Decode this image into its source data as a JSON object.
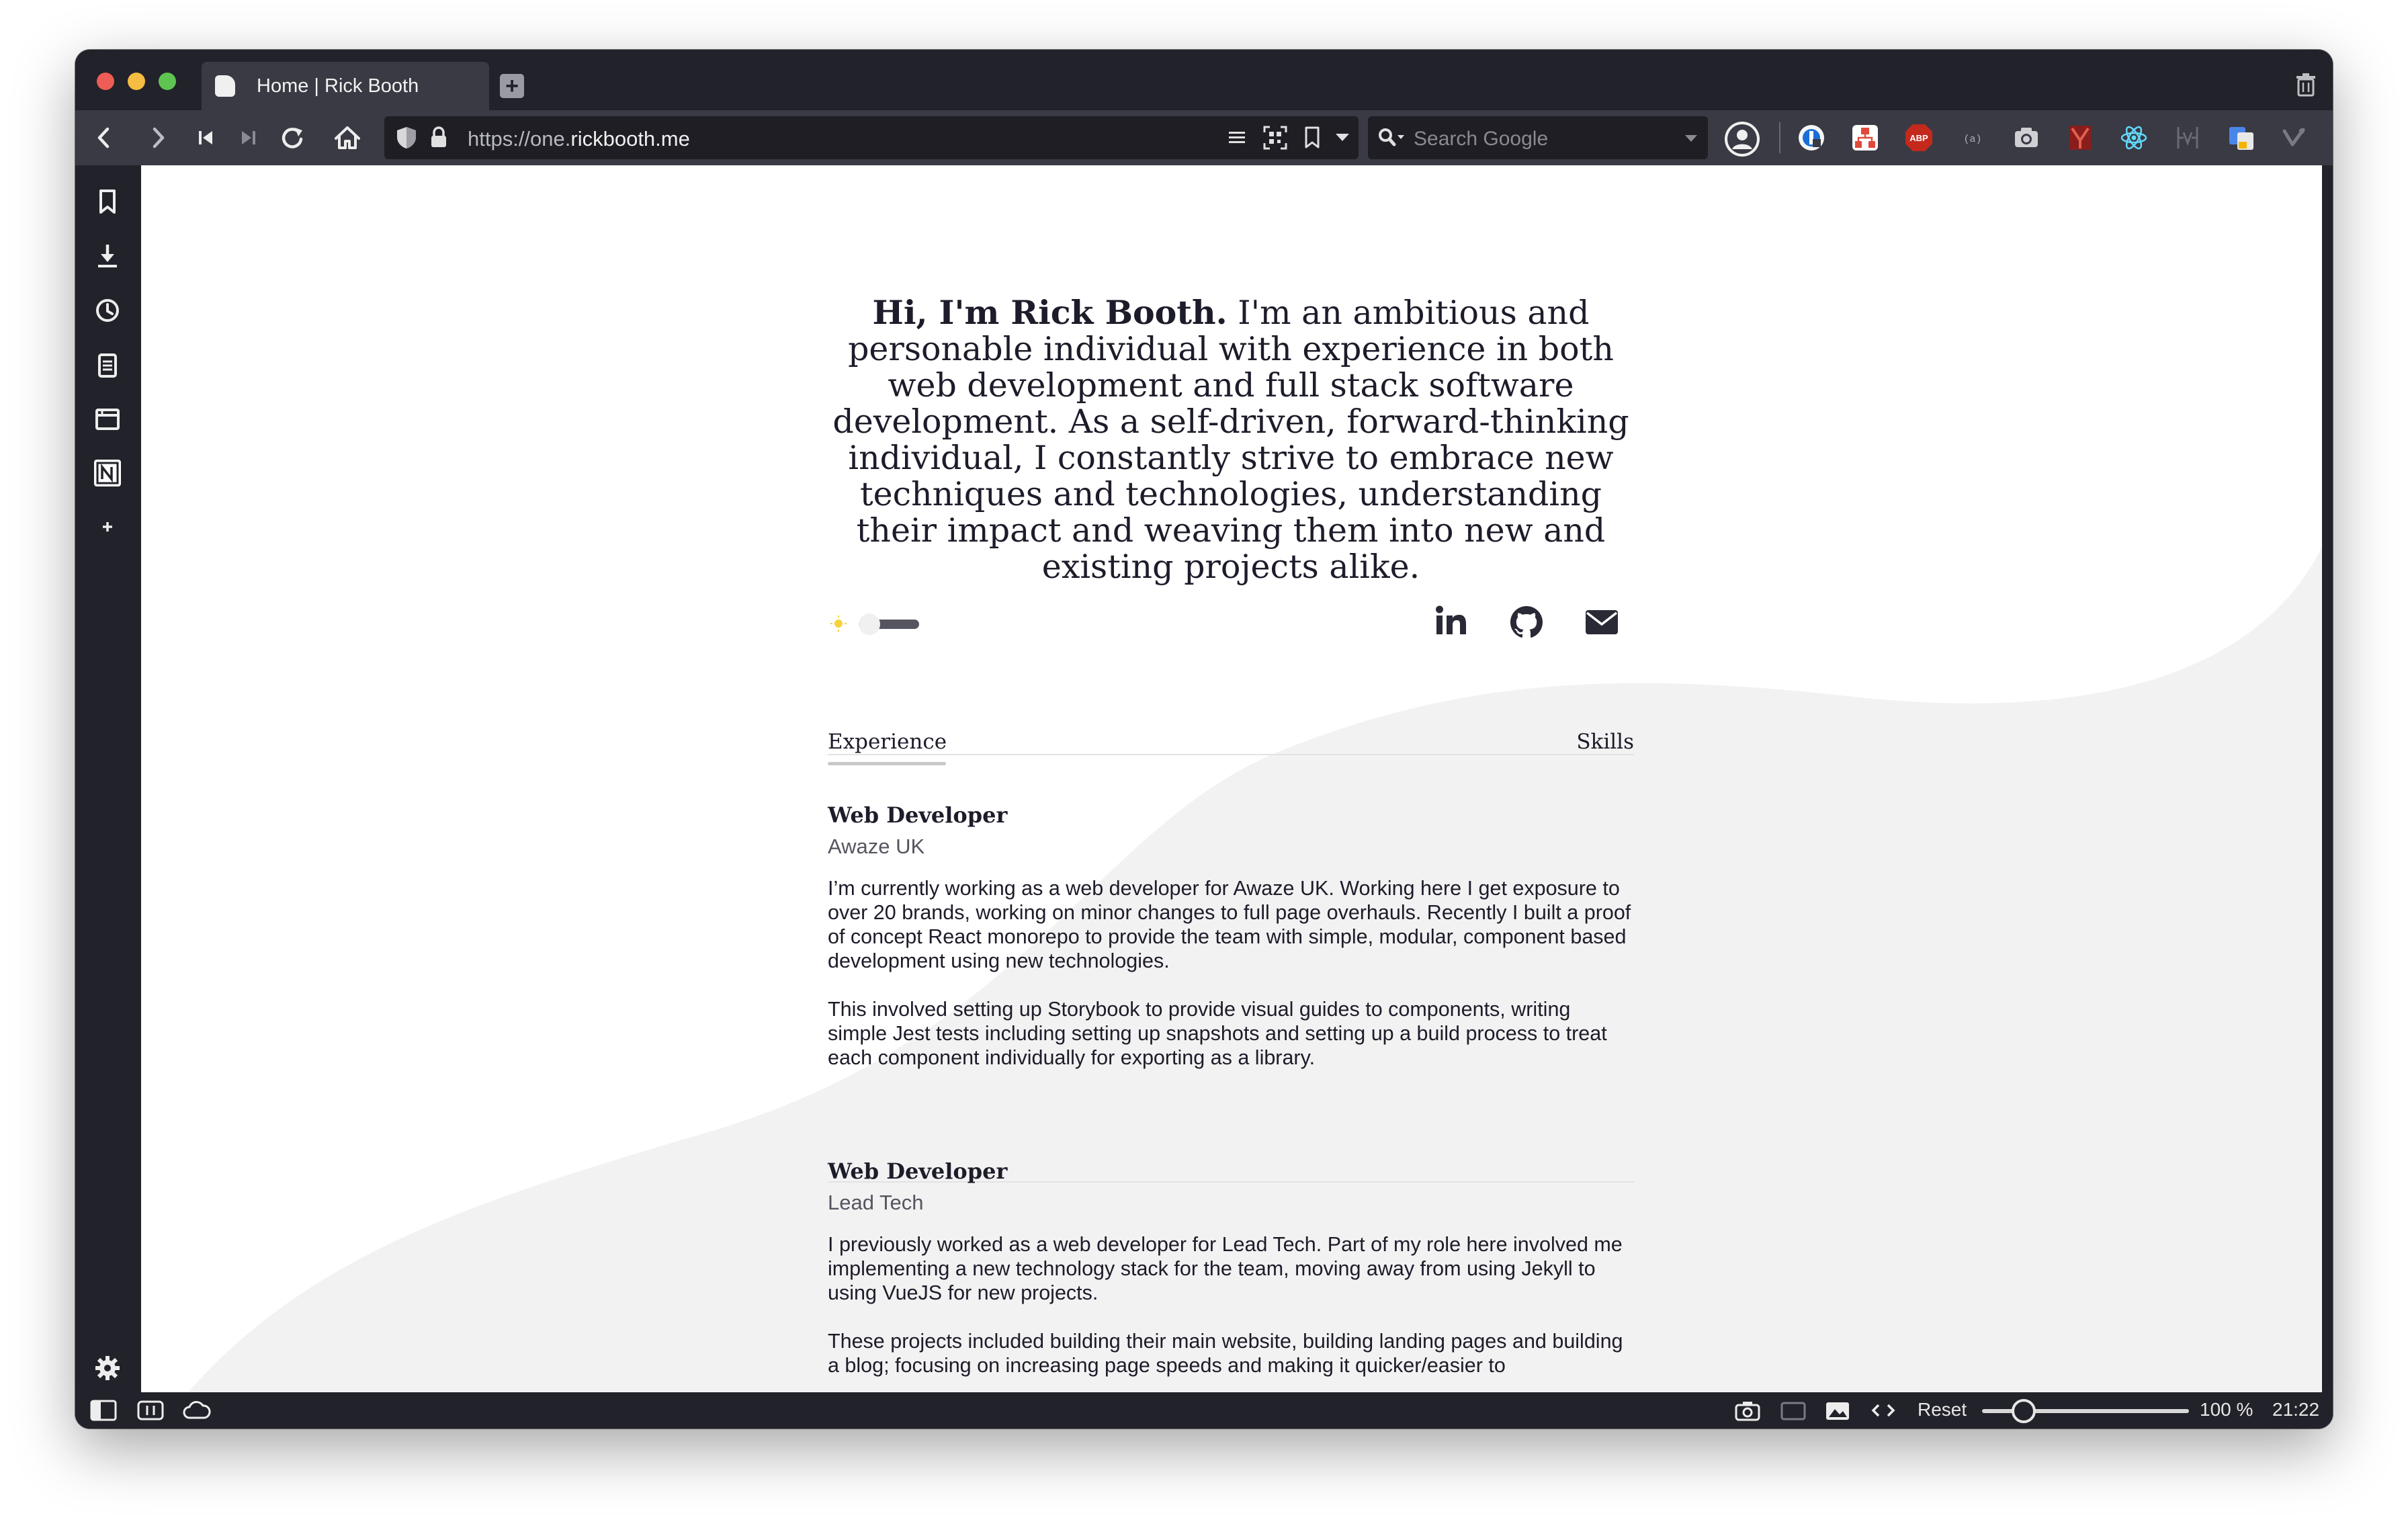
{
  "browser": {
    "tab_title": "Home | Rick Booth",
    "url_prefix": "https://one.",
    "url_domain": "rickbooth.me",
    "search_placeholder": "Search Google",
    "extension_abp_label": "ABP",
    "extension_placeholder_label": "(a)"
  },
  "statusbar": {
    "reset_label": "Reset",
    "zoom_level": "100 %",
    "clock": "21:22",
    "zoom_fraction": 0.2
  },
  "page": {
    "intro_bold": "Hi, I'm Rick Booth.",
    "intro_rest": " I'm an ambitious and personable individual with experience in both web development and full stack software development. As a self-driven, forward-thinking individual, I constantly strive to embrace new techniques and technologies, understanding their impact and weaving them into new and existing projects alike.",
    "theme_toggle": {
      "state": "light"
    },
    "tabs": {
      "experience": "Experience",
      "skills": "Skills"
    },
    "jobs": [
      {
        "title": "Web Developer",
        "company": "Awaze UK",
        "paragraphs": [
          "I’m currently working as a web developer for Awaze UK. Working here I get exposure to over 20 brands, working on minor changes to full page overhauls. Recently I built a proof of concept React monorepo to provide the team with simple, modular, component based development using new technologies.",
          "This involved setting up Storybook to provide visual guides to components, writing simple Jest tests including setting up snapshots and setting up a build process to treat each component individually for exporting as a library."
        ]
      },
      {
        "title": "Web Developer",
        "company": "Lead Tech",
        "paragraphs": [
          "I previously worked as a web developer for Lead Tech. Part of my role here involved me implementing a new technology stack for the team, moving away from using Jekyll to using VueJS for new projects.",
          "These projects included building their main website, building landing pages and building a blog; focusing on increasing page speeds and making it quicker/easier to"
        ]
      }
    ]
  },
  "colors": {
    "chrome_dark": "#22222a",
    "chrome_mid": "#3a3a44",
    "page_bg": "#ffffff",
    "wave": "#f2f2f2",
    "text": "#1c1c2a",
    "abp_red": "#c4291c"
  },
  "icons": {
    "tab": [
      "rickbooth-favicon",
      "new-tab-icon",
      "trash-icon"
    ],
    "nav": [
      "back-icon",
      "forward-icon",
      "rewind-icon",
      "fast-forward-icon",
      "reload-icon",
      "home-icon",
      "shield-icon",
      "lock-icon",
      "reader-icon",
      "qr-code-icon",
      "bookmark-icon",
      "dropdown-icon",
      "search-engine-icon"
    ],
    "side": [
      "bookmarks-icon",
      "downloads-icon",
      "history-icon",
      "notes-icon",
      "window-icon",
      "notion-icon",
      "add-panel-icon",
      "settings-icon"
    ],
    "social": [
      "linkedin-icon",
      "github-icon",
      "email-icon"
    ]
  }
}
